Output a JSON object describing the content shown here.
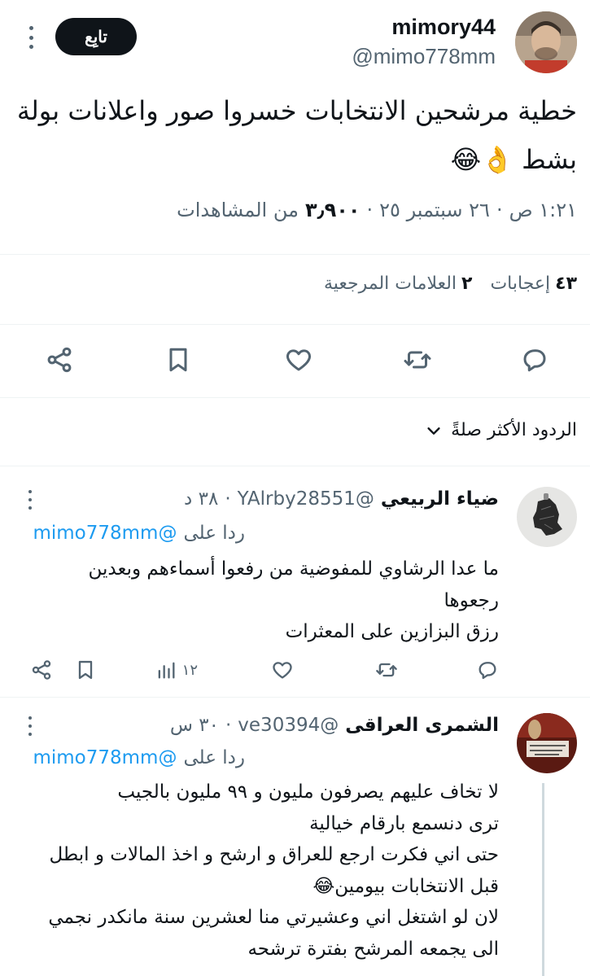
{
  "tweet": {
    "author_name": "mimory44",
    "author_handle": "@mimo778mm",
    "follow_label": "تابِع",
    "text": "خطية مرشحين الانتخابات خسروا صور واعلانات بولة بشط 👌😂",
    "time": "١:٢١ ص",
    "date": "٢٦ سبتمبر ٢٥",
    "views_count": "٣٫٩٠٠",
    "views_label": "من المشاهدات",
    "separator": "·",
    "likes_count": "٤٣",
    "likes_label": "إعجابات",
    "bookmarks_count": "٢",
    "bookmarks_label": "العلامات المرجعية"
  },
  "sort": {
    "label": "الردود الأكثر صلةً"
  },
  "replies": [
    {
      "name": "ضياء الربيعي",
      "handle": "@YAlrby28551",
      "time": "٣٨ د",
      "replying_prefix": "ردا على",
      "replying_to": "@mimo778mm",
      "text": "ما عدا الرشاوي للمفوضية من رفعوا أسماءهم وبعدين\nرجعوها\nرزق البزازين على المعثرات",
      "views": "١٢"
    },
    {
      "name": "الشمرى العراقى",
      "handle": "@ve30394",
      "time": "٣٠ س",
      "replying_prefix": "ردا على",
      "replying_to": "@mimo778mm",
      "text": "لا تخاف عليهم يصرفون مليون و ٩٩ مليون بالجيب\nترى دنسمع بارقام خيالية\nحتى اني فكرت ارجع للعراق و ارشح و اخذ المالات و ابطل\nقبل الانتخابات بيومين😂\nلان لو اشتغل اني وعشيرتي منا لعشرين سنة مانكدر نجمي\nالى يجمعه المرشح بفترة ترشحه"
    }
  ],
  "icons": {
    "reply": "reply-icon",
    "retweet": "retweet-icon",
    "like": "heart-icon",
    "bookmark": "bookmark-icon",
    "share": "share-icon",
    "views": "views-icon",
    "more": "more-icon",
    "chevron": "chevron-down-icon"
  },
  "colors": {
    "link": "#1d9bf0",
    "muted": "#536471",
    "text": "#0f1419"
  }
}
